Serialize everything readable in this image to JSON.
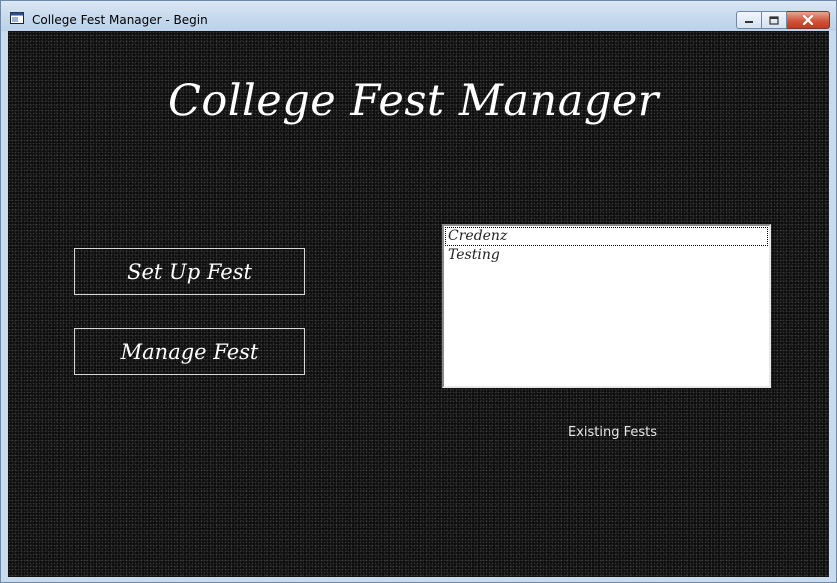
{
  "window": {
    "title": "College Fest Manager - Begin",
    "icon": "app-window-icon"
  },
  "caption_buttons": {
    "minimize_icon": "minimize-icon",
    "maximize_icon": "maximize-icon",
    "close_icon": "close-icon"
  },
  "main": {
    "title": "College Fest Manager",
    "setup_button_label": "Set Up Fest",
    "manage_button_label": "Manage Fest",
    "fests_list": {
      "items": [
        "Credenz",
        "Testing"
      ],
      "focused_index": 0
    },
    "fests_caption": "Existing Fests"
  },
  "colors": {
    "background": "#0d0d0d",
    "text": "#ffffff",
    "list_background": "#ffffff",
    "close_button": "#c9462e"
  }
}
